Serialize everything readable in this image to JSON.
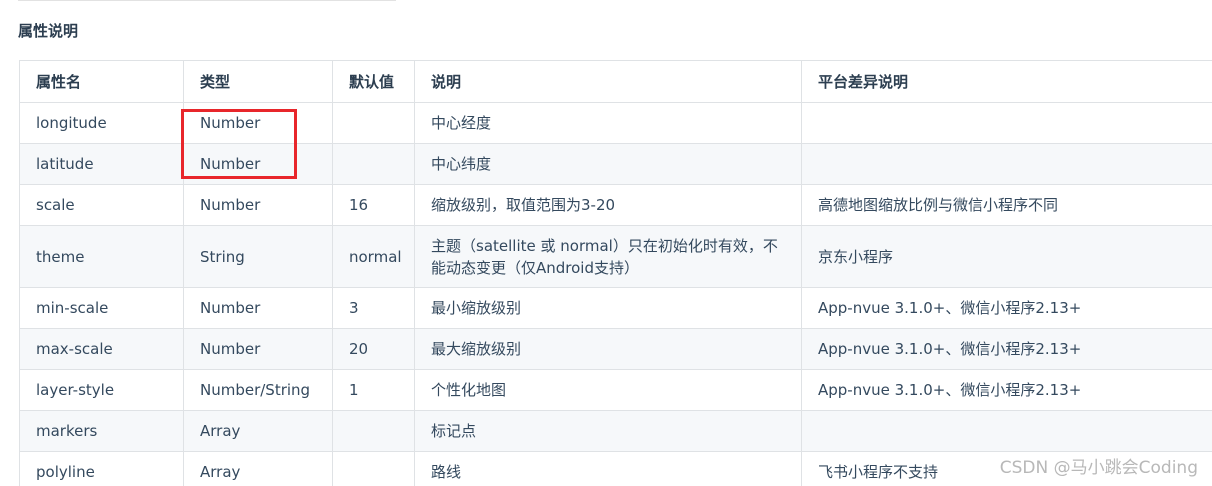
{
  "section_title": "属性说明",
  "table": {
    "headers": [
      "属性名",
      "类型",
      "默认值",
      "说明",
      "平台差异说明"
    ],
    "rows": [
      {
        "name": "longitude",
        "type": "Number",
        "default": "",
        "desc": "中心经度",
        "platform": ""
      },
      {
        "name": "latitude",
        "type": "Number",
        "default": "",
        "desc": "中心纬度",
        "platform": ""
      },
      {
        "name": "scale",
        "type": "Number",
        "default": "16",
        "desc": "缩放级别，取值范围为3-20",
        "platform": "高德地图缩放比例与微信小程序不同"
      },
      {
        "name": "theme",
        "type": "String",
        "default": "normal",
        "desc": "主题（satellite 或 normal）只在初始化时有效，不能动态变更（仅Android支持）",
        "platform": "京东小程序"
      },
      {
        "name": "min-scale",
        "type": "Number",
        "default": "3",
        "desc": "最小缩放级别",
        "platform": "App-nvue 3.1.0+、微信小程序2.13+"
      },
      {
        "name": "max-scale",
        "type": "Number",
        "default": "20",
        "desc": "最大缩放级别",
        "platform": "App-nvue 3.1.0+、微信小程序2.13+"
      },
      {
        "name": "layer-style",
        "type": "Number/String",
        "default": "1",
        "desc": "个性化地图",
        "platform": "App-nvue 3.1.0+、微信小程序2.13+"
      },
      {
        "name": "markers",
        "type": "Array",
        "default": "",
        "desc": "标记点",
        "platform": ""
      },
      {
        "name": "polyline",
        "type": "Array",
        "default": "",
        "desc": "路线",
        "platform": "飞书小程序不支持"
      }
    ]
  },
  "watermark": "CSDN @马小跳会Coding",
  "colors": {
    "highlight": "#e8262b",
    "border": "#dfe2e5",
    "stripe": "#f6f8fa"
  }
}
